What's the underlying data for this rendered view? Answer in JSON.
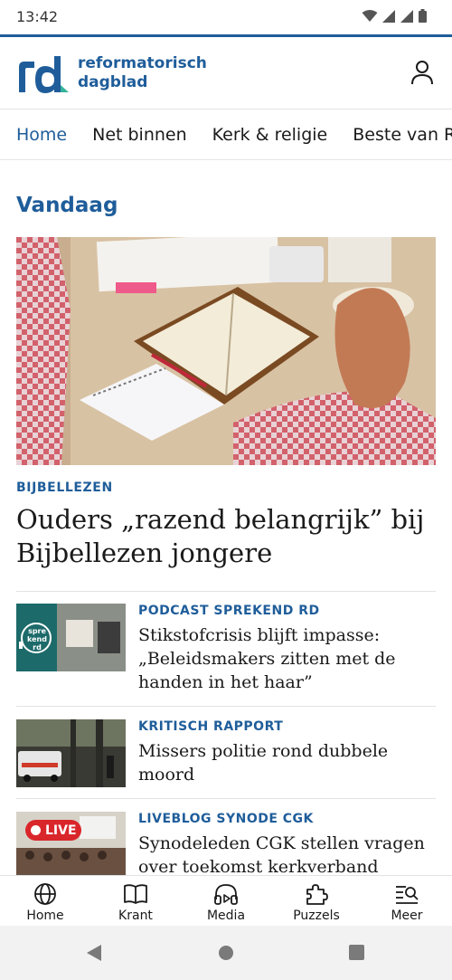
{
  "status": {
    "time": "13:42"
  },
  "header": {
    "logo_line1": "reformatorisch",
    "logo_line2": "dagblad",
    "brand_color": "#1f5d9a"
  },
  "nav": {
    "tabs": [
      {
        "label": "Home",
        "active": true
      },
      {
        "label": "Net binnen",
        "active": false
      },
      {
        "label": "Kerk & religie",
        "active": false
      },
      {
        "label": "Beste van RD",
        "active": false
      }
    ]
  },
  "section": {
    "title": "Vandaag"
  },
  "hero": {
    "kicker": "BIJBELLEZEN",
    "title": "Ouders „razend belangrijk” bij Bijbellezen jongere"
  },
  "articles": [
    {
      "kicker": "PODCAST SPREKEND RD",
      "title": "Stikstofcrisis blijft impasse: „Beleidsmakers zitten met de handen in het haar”",
      "thumb_badge": "spre kend rd"
    },
    {
      "kicker": "KRITISCH RAPPORT",
      "title": "Missers politie rond dubbele moord"
    },
    {
      "kicker": "LIVEBLOG SYNODE CGK",
      "title": "Synodeleden CGK stellen vragen over toekomst kerkverband",
      "thumb_badge": "LIVE"
    }
  ],
  "bottom_nav": {
    "items": [
      {
        "label": "Home",
        "icon": "globe-icon"
      },
      {
        "label": "Krant",
        "icon": "book-icon"
      },
      {
        "label": "Media",
        "icon": "headphones-icon"
      },
      {
        "label": "Puzzels",
        "icon": "puzzle-icon"
      },
      {
        "label": "Meer",
        "icon": "menu-search-icon"
      }
    ]
  }
}
